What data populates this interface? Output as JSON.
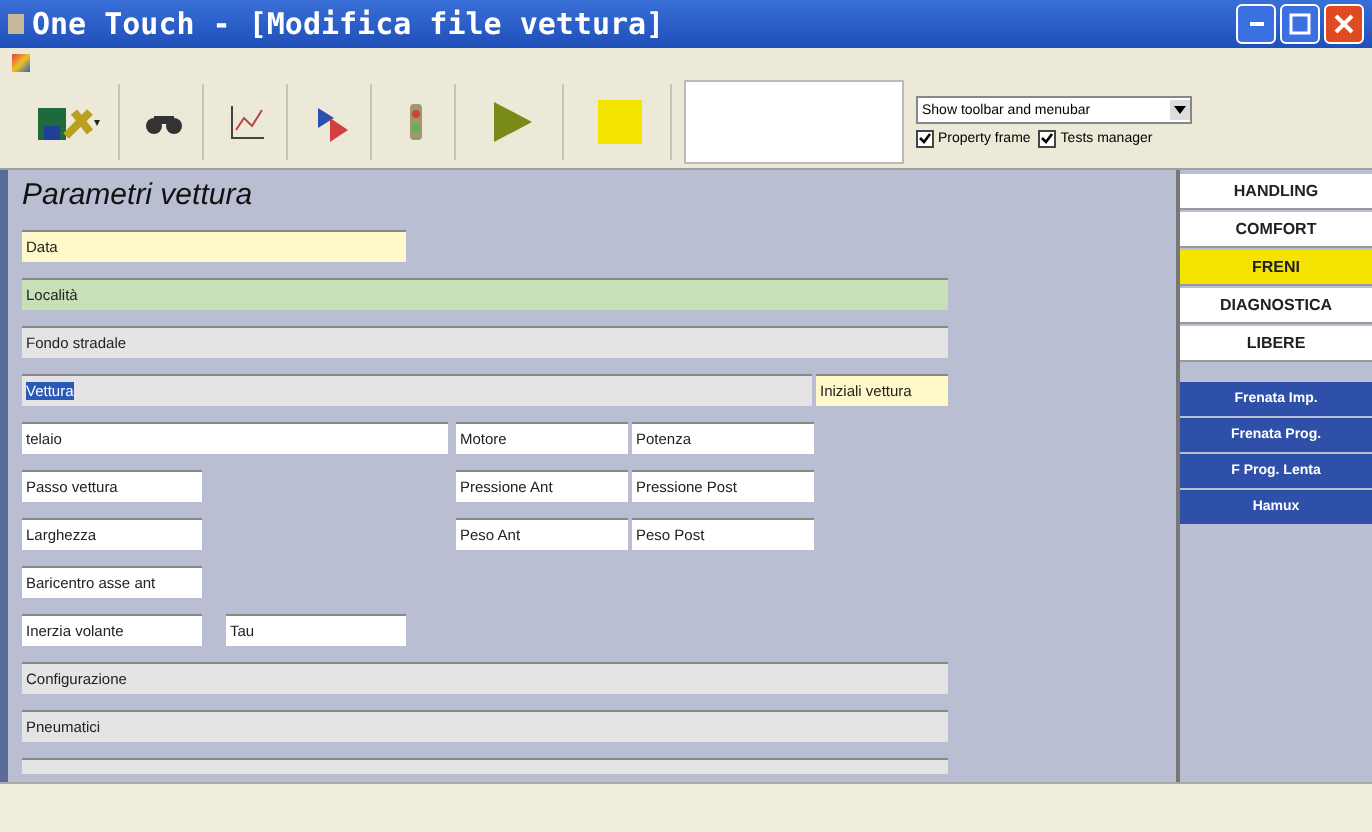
{
  "window": {
    "title": "One Touch - [Modifica file vettura]"
  },
  "toolbar": {
    "dropdown": "Show toolbar and menubar",
    "checks": [
      {
        "label": "Property frame",
        "checked": true
      },
      {
        "label": "Tests manager",
        "checked": true
      }
    ]
  },
  "form": {
    "title": "Parametri vettura",
    "rows": [
      [
        {
          "label": "Data",
          "color": "#fff8c8",
          "selected": false
        }
      ],
      [
        {
          "label": "Località",
          "color": "#c8e0b8",
          "selected": false
        }
      ],
      [
        {
          "label": "Fondo stradale",
          "color": "#e4e4e4",
          "selected": false
        }
      ],
      [
        {
          "label": "Vettura",
          "color": "#e4e4e4",
          "selected": true
        },
        {
          "label": "Iniziali vettura",
          "color": "#fff8c8",
          "selected": false
        }
      ],
      [
        {
          "label": "telaio",
          "color": "#ffffff",
          "selected": false
        },
        {
          "label": "Motore",
          "color": "#ffffff",
          "selected": false
        },
        {
          "label": "Potenza",
          "color": "#ffffff",
          "selected": false
        }
      ],
      [
        {
          "label": "Passo vettura",
          "color": "#ffffff",
          "selected": false
        },
        {
          "label": "Pressione Ant",
          "color": "#ffffff",
          "selected": false
        },
        {
          "label": "Pressione Post",
          "color": "#ffffff",
          "selected": false
        }
      ],
      [
        {
          "label": "Larghezza",
          "color": "#ffffff",
          "selected": false
        },
        {
          "label": "Peso Ant",
          "color": "#ffffff",
          "selected": false
        },
        {
          "label": "Peso Post",
          "color": "#ffffff",
          "selected": false
        }
      ],
      [
        {
          "label": "Baricentro asse ant",
          "color": "#ffffff",
          "selected": false
        }
      ],
      [
        {
          "label": "Inerzia volante",
          "color": "#ffffff",
          "selected": false
        },
        {
          "label": "Tau",
          "color": "#ffffff",
          "selected": false
        }
      ],
      [
        {
          "label": "Configurazione",
          "color": "#e4e4e4",
          "selected": false
        }
      ],
      [
        {
          "label": "Pneumatici",
          "color": "#e4e4e4",
          "selected": false
        }
      ]
    ]
  },
  "tabs": [
    {
      "label": "HANDLING",
      "selected": false
    },
    {
      "label": "COMFORT",
      "selected": false
    },
    {
      "label": "FRENI",
      "selected": true
    },
    {
      "label": "DIAGNOSTICA",
      "selected": false
    },
    {
      "label": "LIBERE",
      "selected": false
    }
  ],
  "tests": [
    "Frenata Imp.",
    "Frenata Prog.",
    "F Prog. Lenta",
    "Hamux"
  ]
}
